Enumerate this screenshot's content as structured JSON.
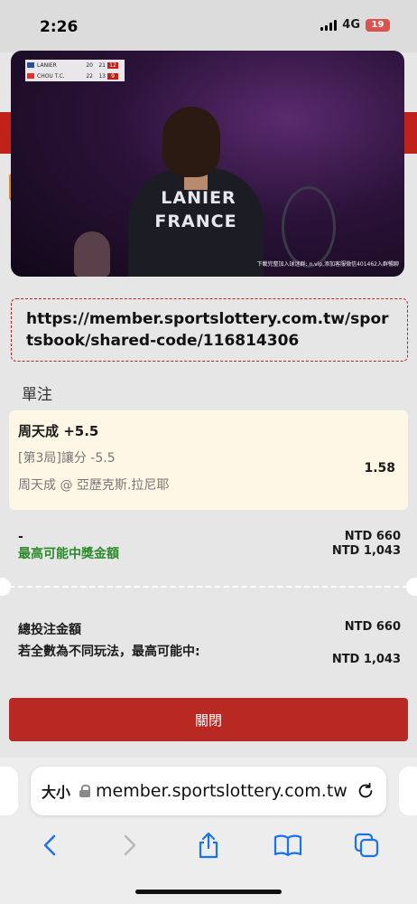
{
  "status_bar": {
    "time": "2:26",
    "network": "4G",
    "battery": "19"
  },
  "video": {
    "scoreboard": [
      {
        "name": "LANIER",
        "s1": "20",
        "s2": "21",
        "cur": "12"
      },
      {
        "name": "CHOU T.C.",
        "s1": "22",
        "s2": "13",
        "cur": "9"
      }
    ],
    "jersey_line1": "LANIER",
    "jersey_line2": "FRANCE",
    "caption": "下載完整加入球迷群: n.vip,添加客服微信401462入群暢聊"
  },
  "shared_link": "https://member.sportslottery.com.tw/sportsbook/shared-code/116814306",
  "section_title": "單注",
  "bet": {
    "selection": "周天成 +5.5",
    "market": "[第3局]讓分 -5.5",
    "match": "周天成 @ 亞歷克斯.拉尼耶",
    "odds": "1.58"
  },
  "summary": {
    "dash": "-",
    "stake_right": "NTD 660",
    "max_win_label": "最高可能中獎金額",
    "max_win_amount": "NTD 1,043"
  },
  "totals": {
    "total_stake_label": "總投注金額",
    "total_stake": "NTD 660",
    "alt_label": "若全數為不同玩法，最高可能中:",
    "alt_amount": "NTD 1,043"
  },
  "close_button": "關閉",
  "browser": {
    "text_size_label": "大小",
    "url": "member.sportslottery.com.tw"
  },
  "colors": {
    "brand_red": "#b72922",
    "win_green": "#2a8a2a",
    "card_bg": "#fff7e6"
  }
}
